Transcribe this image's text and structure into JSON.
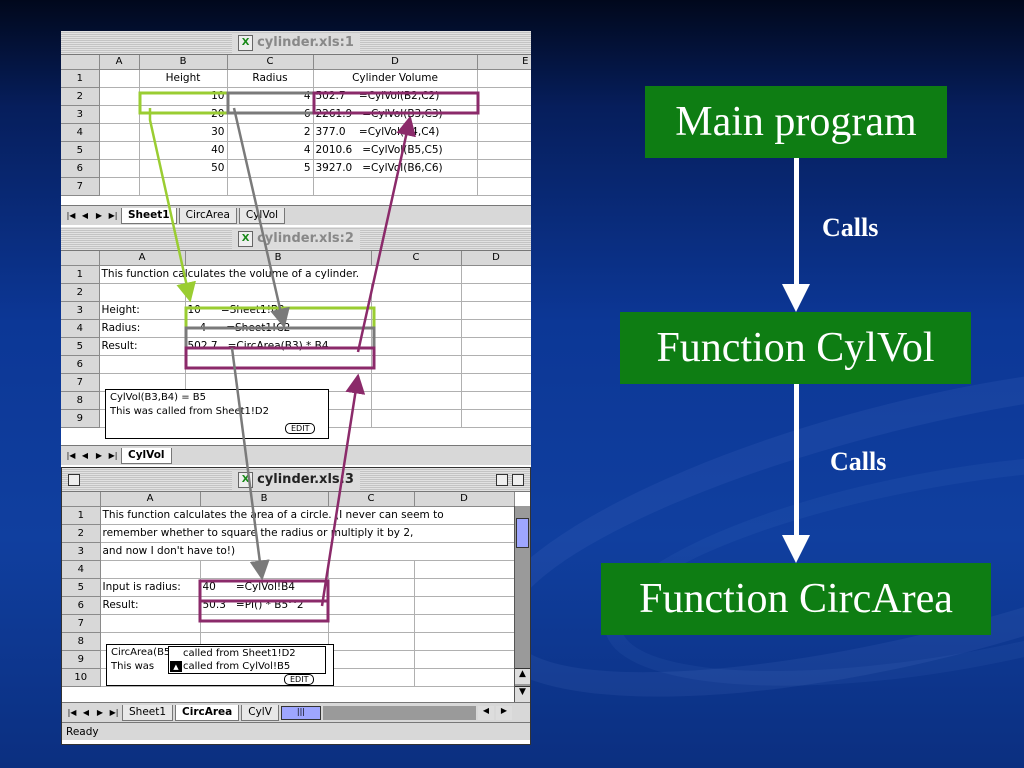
{
  "window1": {
    "title": "cylinder.xls:1",
    "columns": [
      "A",
      "B",
      "C",
      "D",
      "E"
    ],
    "rows": [
      {
        "n": "1",
        "a": "",
        "b": "Height",
        "c": "Radius",
        "d": "Cylinder Volume"
      },
      {
        "n": "2",
        "a": "",
        "b": "10",
        "c": "4",
        "d": "502.7    =CylVol(B2,C2)"
      },
      {
        "n": "3",
        "a": "",
        "b": "20",
        "c": "6",
        "d": "2261.9   =CylVol(B3,C3)"
      },
      {
        "n": "4",
        "a": "",
        "b": "30",
        "c": "2",
        "d": "377.0    =CylVol(B4,C4)"
      },
      {
        "n": "5",
        "a": "",
        "b": "40",
        "c": "4",
        "d": "2010.6   =CylVol(B5,C5)"
      },
      {
        "n": "6",
        "a": "",
        "b": "50",
        "c": "5",
        "d": "3927.0   =CylVol(B6,C6)"
      },
      {
        "n": "7",
        "a": "",
        "b": "",
        "c": "",
        "d": ""
      }
    ],
    "tabs": [
      "Sheet1",
      "CircArea",
      "CylVol"
    ]
  },
  "window2": {
    "title": "cylinder.xls:2",
    "columns": [
      "A",
      "B",
      "C",
      "D"
    ],
    "rows": [
      {
        "n": "1",
        "a": "This function calculates the volume of a cylinder.",
        "b": ""
      },
      {
        "n": "2",
        "a": "",
        "b": ""
      },
      {
        "n": "3",
        "a": "Height:",
        "b": "10      =Sheet1!B2"
      },
      {
        "n": "4",
        "a": "Radius:",
        "b": "4      =Sheet1!C2"
      },
      {
        "n": "5",
        "a": "Result:",
        "b": "502.7   =CircArea(B3) * B4"
      },
      {
        "n": "6",
        "a": "",
        "b": ""
      },
      {
        "n": "7",
        "a": "",
        "b": ""
      },
      {
        "n": "8",
        "a": "",
        "b": ""
      },
      {
        "n": "9",
        "a": "",
        "b": ""
      }
    ],
    "note_line1": "CylVol(B3,B4) = B5",
    "note_line2": "This was called from Sheet1!D2",
    "edit_label": "EDIT",
    "tab": "CylVol"
  },
  "window3": {
    "title": "cylinder.xls:3",
    "columns": [
      "A",
      "B",
      "C",
      "D"
    ],
    "rows": [
      {
        "n": "1",
        "a": "This function calculates the area of a circle.  (I never can seem to",
        "b": ""
      },
      {
        "n": "2",
        "a": "remember whether to square the radius or multiply it by 2,",
        "b": ""
      },
      {
        "n": "3",
        "a": "and now I don't have to!)",
        "b": ""
      },
      {
        "n": "4",
        "a": "",
        "b": ""
      },
      {
        "n": "5",
        "a": "Input is radius:",
        "b": "40      =CylVol!B4"
      },
      {
        "n": "6",
        "a": "Result:",
        "b": "50.3   =PI() * B5^2"
      },
      {
        "n": "7",
        "a": "",
        "b": ""
      },
      {
        "n": "8",
        "a": "",
        "b": ""
      },
      {
        "n": "9",
        "a": "",
        "b": ""
      },
      {
        "n": "10",
        "a": "",
        "b": ""
      }
    ],
    "note_line1": "CircArea(B5",
    "note_line2": "This was",
    "popup_line1": "called from Sheet1!D2",
    "popup_line2": "called from CylVol!B5",
    "edit_label": "EDIT",
    "tabs": [
      "Sheet1",
      "CircArea",
      "CylV"
    ],
    "status": "Ready"
  },
  "flow": {
    "main_program": "Main program",
    "calls_1": "Calls",
    "function_cylvol": "Function CylVol",
    "calls_2": "Calls",
    "function_circarea": "Function CircArea"
  },
  "colors": {
    "box_green": "#0e7d13",
    "highlight_green": "#9acd32",
    "highlight_purple": "#8b2a6a",
    "highlight_gray": "#7a7a7a"
  }
}
